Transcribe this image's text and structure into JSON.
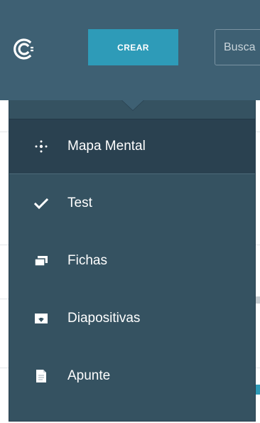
{
  "header": {
    "create_label": "CREAR",
    "search_placeholder": "Busca"
  },
  "menu": {
    "items": [
      {
        "label": "Mapa Mental",
        "icon": "mindmap-icon",
        "active": true
      },
      {
        "label": "Test",
        "icon": "checkmark-icon",
        "active": false
      },
      {
        "label": "Fichas",
        "icon": "flashcards-icon",
        "active": false
      },
      {
        "label": "Diapositivas",
        "icon": "slides-icon",
        "active": false
      },
      {
        "label": "Apunte",
        "icon": "note-icon",
        "active": false
      }
    ]
  },
  "colors": {
    "header_bg": "#3e6073",
    "create_button_bg": "#2e9bb8",
    "dropdown_bg": "#355261",
    "active_item_bg": "#2a4150"
  }
}
